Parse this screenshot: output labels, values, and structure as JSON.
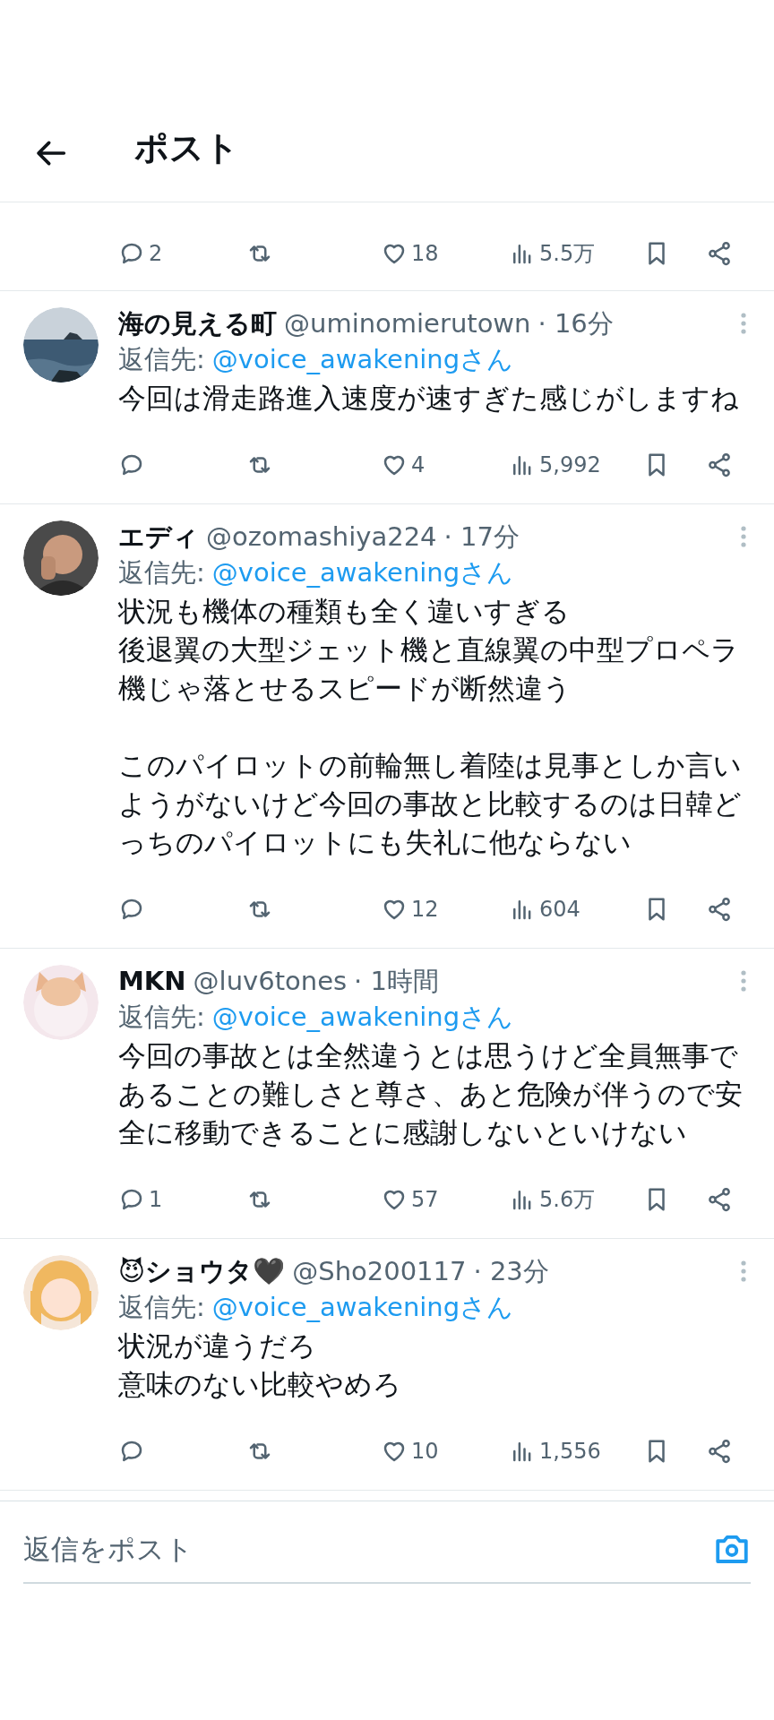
{
  "header": {
    "title": "ポスト"
  },
  "partial_post": {
    "actions": {
      "replies": "2",
      "likes": "18",
      "views": "5.5万"
    }
  },
  "posts": [
    {
      "avatar": {
        "kind": "picture"
      },
      "name": "海の見える町",
      "handle": "@uminomierutown",
      "time": "· 16分",
      "reply_label": "返信先:",
      "reply_to": "@voice_awakeningさん",
      "paragraphs": [
        [
          "今回は滑走路進入速度が速すぎた感じがしますね"
        ]
      ],
      "actions": {
        "likes": "4",
        "views": "5,992"
      }
    },
    {
      "avatar": {
        "kind": "picture"
      },
      "name": "エディ",
      "handle": "@ozomashiya224",
      "time": "· 17分",
      "reply_label": "返信先:",
      "reply_to": "@voice_awakeningさん",
      "paragraphs": [
        [
          "状況も機体の種類も全く違いすぎる",
          "後退翼の大型ジェット機と直線翼の中型プロペラ機じゃ落とせるスピードが断然違う"
        ],
        [
          "このパイロットの前輪無し着陸は見事としか言いようがないけど今回の事故と比較するのは日韓どっちのパイロットにも失礼に他ならない"
        ]
      ],
      "actions": {
        "likes": "12",
        "views": "604"
      }
    },
    {
      "avatar": {
        "kind": "picture"
      },
      "name": "MKN",
      "handle": "@luv6tones",
      "time": "· 1時間",
      "reply_label": "返信先:",
      "reply_to": "@voice_awakeningさん",
      "paragraphs": [
        [
          "今回の事故とは全然違うとは思うけど全員無事であることの難しさと尊さ、あと危険が伴うので安全に移動できることに感謝しないといけない"
        ]
      ],
      "actions": {
        "replies": "1",
        "likes": "57",
        "views": "5.6万"
      }
    },
    {
      "avatar": {
        "kind": "picture"
      },
      "name": "😈ショウタ🖤",
      "handle": "@Sho200117",
      "time": "· 23分",
      "reply_label": "返信先:",
      "reply_to": "@voice_awakeningさん",
      "paragraphs": [
        [
          "状況が違うだろ",
          "意味のない比較やめろ"
        ]
      ],
      "actions": {
        "likes": "10",
        "views": "1,556"
      }
    }
  ],
  "reply_bar": {
    "placeholder": "返信をポスト"
  }
}
